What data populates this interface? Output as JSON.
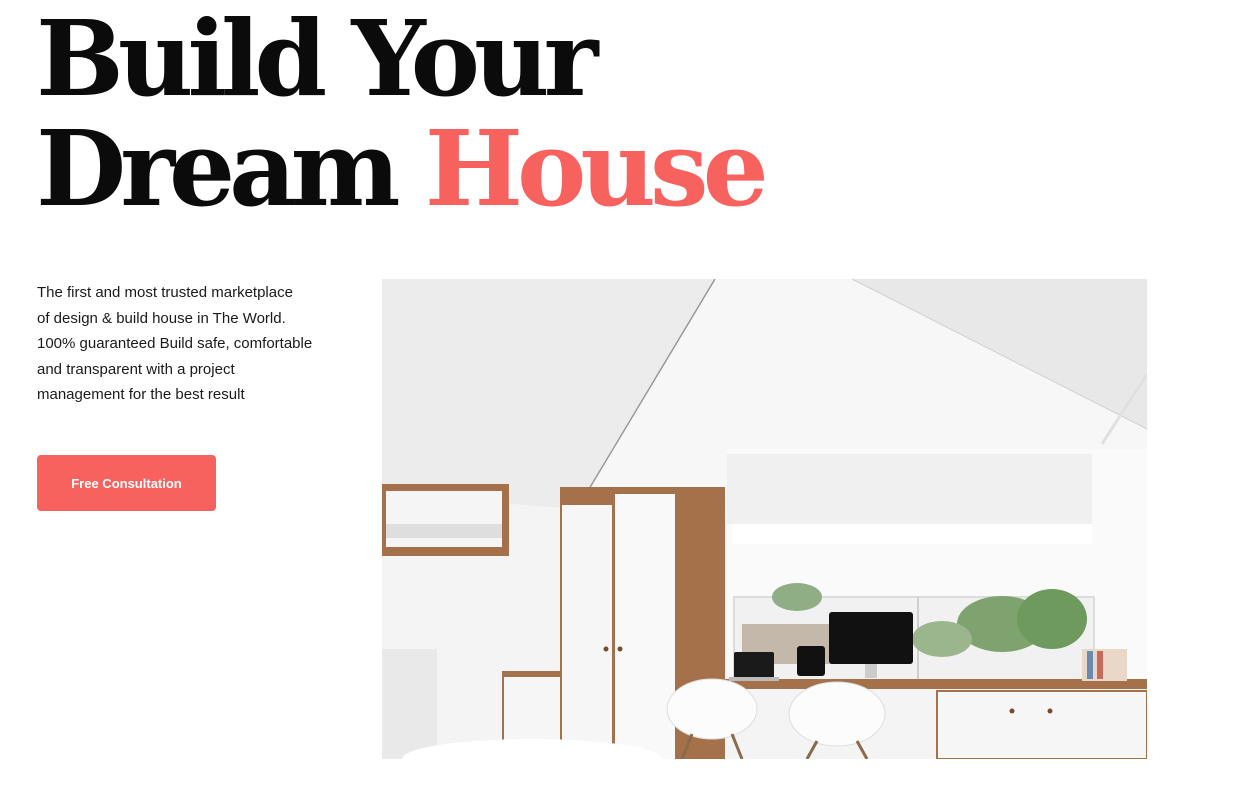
{
  "hero": {
    "title_line1": "Build Your",
    "title_line2_prefix": "Dream",
    "title_line2_accent": "House",
    "description_lines": [
      "The first and most trusted marketplace",
      "of design & build house in The World.",
      "100% guaranteed Build safe, comfortable",
      "and transparent with a project",
      "management for the best result"
    ],
    "cta_label": "Free Consultation"
  },
  "colors": {
    "accent": "#f7625f",
    "text": "#0b0b0b",
    "background": "#ffffff"
  }
}
